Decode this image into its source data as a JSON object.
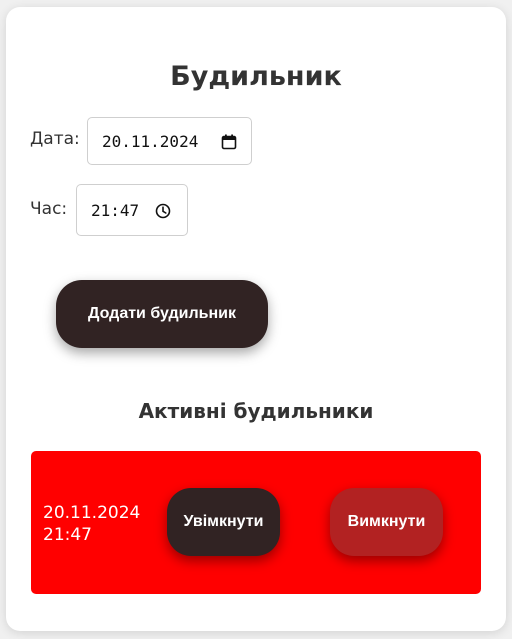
{
  "app": {
    "title": "Будильник"
  },
  "form": {
    "date_label": "Дата:",
    "date_value": "20.11.2024",
    "date_icon": "calendar-icon",
    "time_label": "Час:",
    "time_value": "21:47",
    "time_icon": "clock-icon",
    "add_button_label": "Додати будильник"
  },
  "alarms": {
    "heading": "Активні будильники",
    "items": [
      {
        "date": "20.11.2024",
        "time": "21:47",
        "enable_label": "Увімкнути",
        "disable_label": "Вимкнути"
      }
    ]
  },
  "colors": {
    "primary_button": "#312323",
    "disable_button": "#b22222",
    "alarm_row_background": "#ff0000"
  }
}
